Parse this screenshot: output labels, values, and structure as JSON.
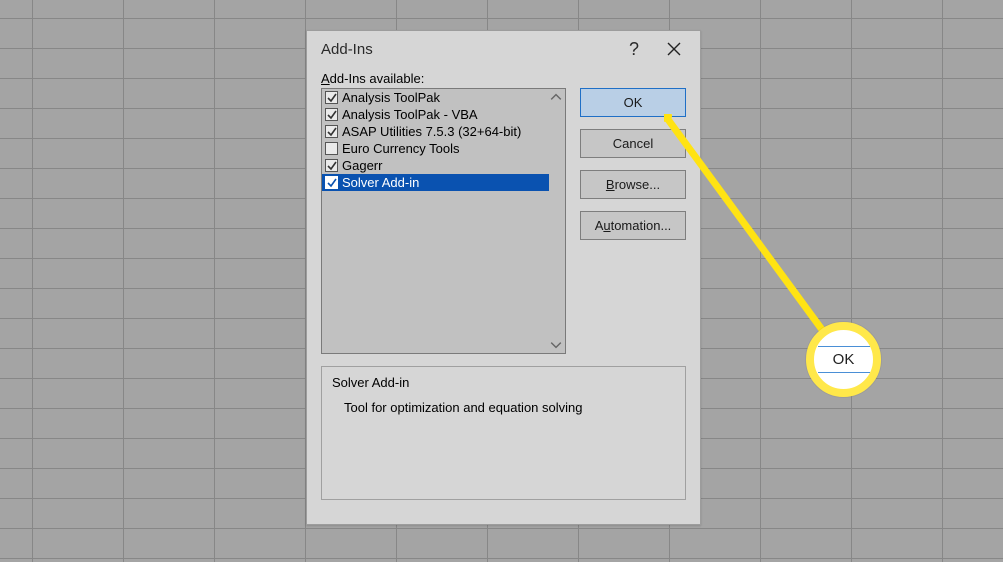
{
  "dialog": {
    "title": "Add-Ins",
    "help_symbol": "?",
    "list_label_pre": "A",
    "list_label_rest": "dd-Ins available:",
    "buttons": {
      "ok": "OK",
      "cancel": "Cancel",
      "browse_pre": "B",
      "browse_rest": "rowse...",
      "automation_pre": "A",
      "automation_u": "u",
      "automation_rest": "tomation..."
    },
    "items": [
      {
        "label": "Analysis ToolPak",
        "checked": true,
        "selected": false
      },
      {
        "label": "Analysis ToolPak - VBA",
        "checked": true,
        "selected": false
      },
      {
        "label": "ASAP Utilities 7.5.3 (32+64-bit)",
        "checked": true,
        "selected": false
      },
      {
        "label": "Euro Currency Tools",
        "checked": false,
        "selected": false
      },
      {
        "label": "Gagerr",
        "checked": true,
        "selected": false
      },
      {
        "label": "Solver Add-in",
        "checked": true,
        "selected": true
      }
    ],
    "description": {
      "title": "Solver Add-in",
      "text": "Tool for optimization and equation solving"
    }
  },
  "callout": {
    "label": "OK"
  }
}
